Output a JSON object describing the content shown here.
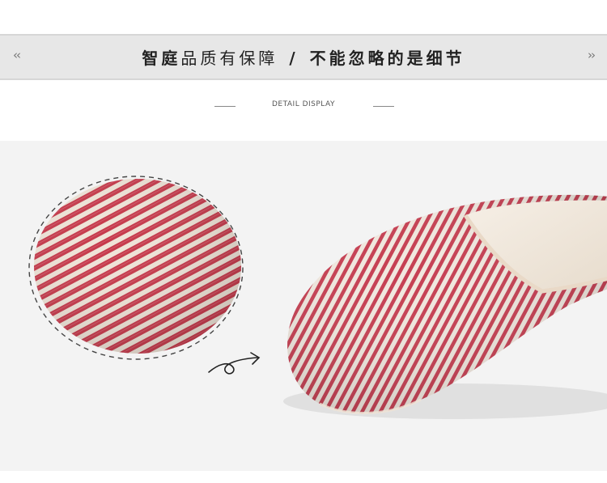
{
  "header": {
    "nav_prev": "‹‹",
    "nav_next": "››",
    "title_part1": "智庭",
    "title_part2": "品质有保障",
    "separator": "/",
    "title_part3": "不能忽略的是细节"
  },
  "detail": {
    "caption": "DETAIL DISPLAY"
  },
  "colors": {
    "band": "#e7e7e7",
    "stripe": "#c23a48",
    "background": "#f3f3f3"
  },
  "images": {
    "detail_closeup": "striped-fabric-closeup",
    "product": "red-white-striped-slipper",
    "arrow": "curly-arrow-icon"
  }
}
